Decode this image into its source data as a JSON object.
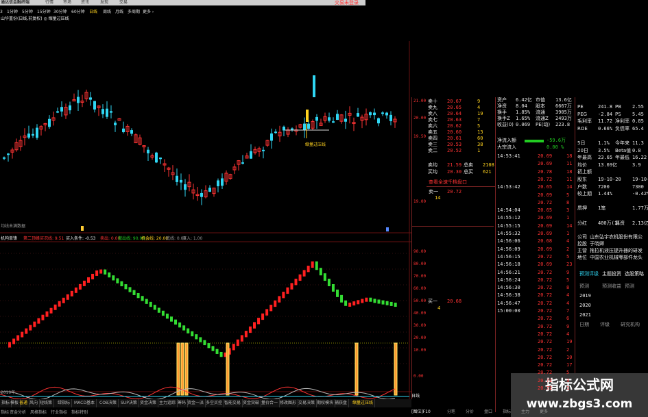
{
  "topbar": {
    "brand": "通达信金融终端",
    "tabs": [
      "行情",
      "市场",
      "资讯",
      "发现",
      "交易"
    ],
    "trade_hint": "交易未登录"
  },
  "periods": [
    "3",
    "1分钟",
    "5分钟",
    "15分钟",
    "30分钟",
    "60分钟",
    "日线",
    "周线",
    "月线",
    "多周期",
    "更多 ›"
  ],
  "stock_line": "山华重份(日线,前复权) ◎ 缩量过压线",
  "main_chart": {
    "right_labels": [
      "21.00",
      "20.00",
      "19.50",
      "19.00"
    ],
    "annotation": "缩量过压线",
    "bottom_text": "均线未满数据"
  },
  "indicator": {
    "name": "机构单锋",
    "params": [
      {
        "text": "第二顶峰买况线: 9.51",
        "color": "#ff3333"
      },
      {
        "text": "买入条件: -0.53",
        "color": "#e8e8e8"
      },
      {
        "text": "卖出: 0.00",
        "color": "#ff3333"
      },
      {
        "text": "撤出线: 90.00",
        "color": "#22cc22"
      },
      {
        "text": "机会线: 20.00",
        "color": "#ffd21f"
      },
      {
        "text": "底线: 0.00",
        "color": "#999999"
      },
      {
        "text": "买入: 1.00",
        "color": "#999999"
      }
    ],
    "y_labels": [
      "90.00",
      "80.00",
      "70.00",
      "60.00",
      "50.00",
      "40.00",
      "30.00",
      "20.00",
      "10.00",
      "0.00"
    ],
    "bottom_left": "2019年"
  },
  "quote": {
    "top_rows": [
      {
        "l": "资产",
        "v": "6.42亿",
        "l2": "市值",
        "v2": "13.6亿"
      },
      {
        "l": "净资",
        "v": "8.04",
        "l2": "股本",
        "v2": "6667万"
      },
      {
        "l": "换手",
        "v": "1.85%",
        "l2": "流通",
        "v2": "3905万"
      },
      {
        "l": "换手Z",
        "v": "1.65%",
        "l2": "流通Z",
        "v2": "2493万"
      },
      {
        "l": "收益(0)",
        "v": "0.069",
        "l2": "PE(动)",
        "v2": "223.8"
      }
    ],
    "order_book": [
      {
        "lvl": "卖十",
        "p": "20.67",
        "v": "9"
      },
      {
        "lvl": "卖九",
        "p": "20.65",
        "v": "4"
      },
      {
        "lvl": "卖八",
        "p": "20.64",
        "v": "19"
      },
      {
        "lvl": "卖七",
        "p": "20.63",
        "v": "7"
      },
      {
        "lvl": "卖六",
        "p": "20.62",
        "v": "5"
      },
      {
        "lvl": "卖五",
        "p": "20.60",
        "v": "13"
      },
      {
        "lvl": "卖四",
        "p": "20.61",
        "v": "60"
      },
      {
        "lvl": "卖三",
        "p": "20.53",
        "v": "38"
      },
      {
        "lvl": "卖二",
        "p": "20.52",
        "v": "1"
      }
    ],
    "summary": [
      {
        "l": "卖均",
        "p": "21.59",
        "l2": "总卖",
        "v": "2108"
      },
      {
        "l": "买均",
        "p": "20.30",
        "l2": "总买",
        "v": "621"
      }
    ],
    "sell1_label": "卖一",
    "sell1_price": "20.72",
    "sell1_vol": "14",
    "buy1_label": "买一",
    "buy1_price": "20.68",
    "buy1_vol": "4",
    "banner": "查看全速千档盘口"
  },
  "fund": {
    "rows": [
      {
        "l": "净流入额",
        "v": "-59.6万"
      },
      {
        "l": "大宗流入",
        "v": "0.00 %"
      }
    ]
  },
  "ticks": [
    {
      "t": "14:53:41",
      "p": "20.69",
      "v": "18"
    },
    {
      "t": "",
      "p": "20.69",
      "v": "11"
    },
    {
      "t": "",
      "p": "20.78",
      "v": "18"
    },
    {
      "t": "",
      "p": "20.72",
      "v": "11"
    },
    {
      "t": "14:53:42",
      "p": "20.65",
      "v": "14"
    },
    {
      "t": "",
      "p": "20.69",
      "v": "5"
    },
    {
      "t": "",
      "p": "20.72",
      "v": "8"
    },
    {
      "t": "14:54:04",
      "p": "20.65",
      "v": "3"
    },
    {
      "t": "14:55:12",
      "p": "20.69",
      "v": "1"
    },
    {
      "t": "14:55:15",
      "p": "20.69",
      "v": "14"
    },
    {
      "t": "14:55:32",
      "p": "20.69",
      "v": "1"
    },
    {
      "t": "14:56:06",
      "p": "20.68",
      "v": "4"
    },
    {
      "t": "14:56:09",
      "p": "20.69",
      "v": "2"
    },
    {
      "t": "14:56:15",
      "p": "20.72",
      "v": "5"
    },
    {
      "t": "14:56:18",
      "p": "20.69",
      "v": "23"
    },
    {
      "t": "14:56:21",
      "p": "20.72",
      "v": "9"
    },
    {
      "t": "14:56:24",
      "p": "20.72",
      "v": "5"
    },
    {
      "t": "14:56:30",
      "p": "20.72",
      "v": "8"
    },
    {
      "t": "14:56:38",
      "p": "20.72",
      "v": "4"
    },
    {
      "t": "14:56:47",
      "p": "20.72",
      "v": "4"
    },
    {
      "t": "15:00:00",
      "p": "20.72",
      "v": "7"
    },
    {
      "t": "",
      "p": "20.72",
      "v": "6"
    },
    {
      "t": "",
      "p": "20.72",
      "v": "9"
    },
    {
      "t": "",
      "p": "20.72",
      "v": "4"
    },
    {
      "t": "",
      "p": "20.72",
      "v": "19"
    },
    {
      "t": "",
      "p": "20.72",
      "v": "2"
    },
    {
      "t": "",
      "p": "20.72",
      "v": "10"
    },
    {
      "t": "",
      "p": "20.72",
      "v": "17"
    },
    {
      "t": "",
      "p": "20.72",
      "v": "5"
    },
    {
      "t": "",
      "p": "20.72",
      "v": "3"
    },
    {
      "t": "",
      "p": "20.72",
      "v": "1"
    }
  ],
  "fin": {
    "rows": [
      {
        "l": "PE",
        "v": "241.8",
        "l2": "PB",
        "v2": "2.55"
      },
      {
        "l": "PEG",
        "v": "-2.84",
        "l2": "PS",
        "v2": "5.45"
      },
      {
        "l": "毛利率",
        "v": "11.72",
        "l2": "净利率",
        "v2": "0.85"
      },
      {
        "l": "ROE",
        "v": "0.66%",
        "l2": "负债率",
        "v2": "65.4"
      },
      {
        "l": "",
        "v": "",
        "l2": "",
        "v2": ""
      },
      {
        "l": "5日",
        "v": "1.1%",
        "l2": "今年来",
        "v2": "11.3"
      },
      {
        "l": "20日",
        "v": "3.5%",
        "l2": "Beta值",
        "v2": "0.8"
      },
      {
        "l": "年最高",
        "v": "23.65",
        "l2": "年最低",
        "v2": "16.22"
      },
      {
        "l": "均价",
        "v": "13.69亿",
        "l2": "",
        "v2": "3.9"
      },
      {
        "l": "初上额",
        "v": "",
        "l2": "",
        "v2": ""
      },
      {
        "l": "股东",
        "v": "19-10-20",
        "l2": "",
        "v2": "19-10-10"
      },
      {
        "l": "户数",
        "v": "7200",
        "l2": "",
        "v2": "7300"
      },
      {
        "l": "较上期",
        "v": "1.44%",
        "l2": "",
        "v2": "-0.42%"
      },
      {
        "l": "",
        "v": "",
        "l2": "",
        "v2": ""
      },
      {
        "l": "质押",
        "v": "1笔",
        "l2": "",
        "v2": "1.77万股"
      },
      {
        "l": "",
        "v": "",
        "l2": "",
        "v2": ""
      },
      {
        "l": "分红",
        "v": "400万(1)",
        "l2": "募资",
        "v2": "2.13亿(1)"
      }
    ],
    "company_lines": [
      {
        "l": "公司",
        "v": "山东弘宇农机股份有限公"
      },
      {
        "l": "控股",
        "v": "于晓卿"
      },
      {
        "l": "主营",
        "v": "拖拉机液压提升器的研发"
      },
      {
        "l": "地位",
        "v": "中国农业机械零部件龙头"
      }
    ],
    "tabs": [
      "预测评级",
      "主题投资",
      "选股策略"
    ],
    "forecast_header": [
      "预测",
      "预测收益",
      "预测"
    ],
    "years": [
      "2019",
      "2020",
      "2021"
    ],
    "rating_header": [
      "日期",
      "评级",
      "研究机构"
    ]
  },
  "right_tabs": [
    "分笔",
    "分价",
    "盘口",
    "指标",
    "主力",
    "更多"
  ],
  "bottom_buttons": [
    "指标",
    "模板",
    "普通",
    "风向",
    "短线策",
    "绿指标",
    "MACD基本",
    "COB决策",
    "SUP决策",
    "资金决策",
    "主力追踪",
    "筹码",
    "资金一派",
    "多空买控",
    "智能交易",
    "资金突破",
    "量价合一",
    "修改图形",
    "交易决策",
    "期权模块",
    "捕获盘",
    "缩量过压线"
  ],
  "bottom_buttons2": [
    "指标",
    "资金分析",
    "风格指标",
    "行业指标",
    "指标特别"
  ],
  "bottom_right": "日线",
  "right_bottom_tab": "[图位]F10",
  "watermark": {
    "title": "指标公式网",
    "url": "www.zbgs3.com"
  }
}
